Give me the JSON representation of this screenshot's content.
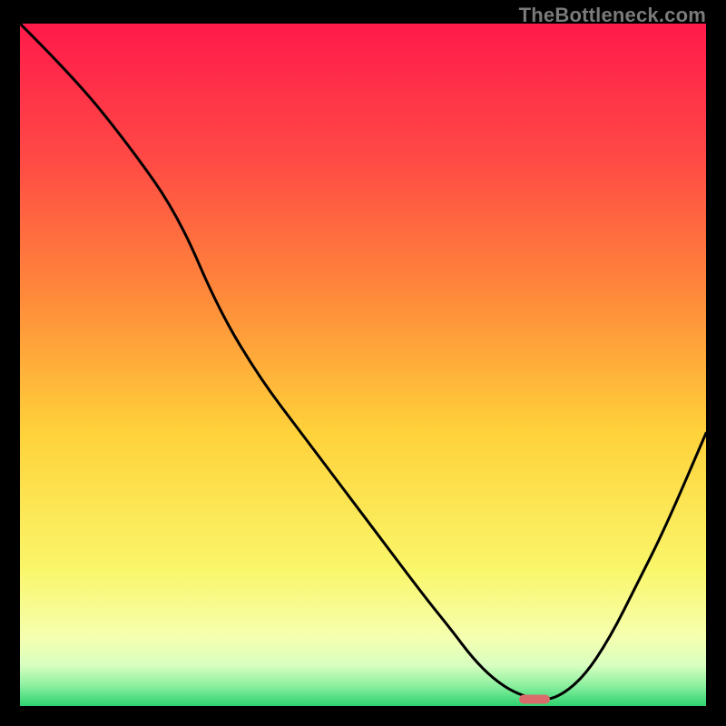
{
  "watermark": "TheBottleneck.com",
  "chart_data": {
    "type": "line",
    "title": "",
    "xlabel": "",
    "ylabel": "",
    "xlim": [
      0,
      100
    ],
    "ylim": [
      0,
      100
    ],
    "grid": false,
    "legend": false,
    "series": [
      {
        "name": "curve",
        "x": [
          0,
          8,
          16,
          23,
          29,
          35,
          41,
          47,
          53,
          59,
          63,
          66,
          69,
          72,
          75,
          78,
          82,
          86,
          90,
          94,
          100
        ],
        "values": [
          100,
          92,
          82,
          72,
          58,
          48,
          40,
          32,
          24,
          16,
          11,
          7,
          4,
          2,
          1,
          1,
          4,
          10,
          18,
          26,
          40
        ]
      }
    ],
    "optimal_marker": {
      "x": 75,
      "y": 1
    },
    "gradient_stops": [
      {
        "offset": 0.0,
        "color": "#ff1a4b"
      },
      {
        "offset": 0.2,
        "color": "#ff4a45"
      },
      {
        "offset": 0.4,
        "color": "#ff8a3a"
      },
      {
        "offset": 0.6,
        "color": "#ffd23a"
      },
      {
        "offset": 0.8,
        "color": "#faf66a"
      },
      {
        "offset": 0.9,
        "color": "#f5ffb0"
      },
      {
        "offset": 0.94,
        "color": "#d8ffc0"
      },
      {
        "offset": 0.97,
        "color": "#8cf0a0"
      },
      {
        "offset": 1.0,
        "color": "#2dd36f"
      }
    ],
    "marker_color": "#d96b6b"
  }
}
